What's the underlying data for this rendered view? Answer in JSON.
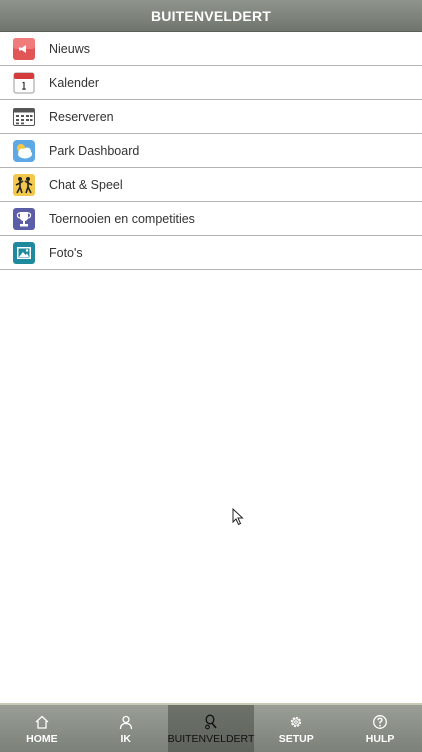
{
  "header": {
    "title": "BUITENVELDERT"
  },
  "menu": {
    "items": [
      {
        "label": "Nieuws",
        "icon": "megaphone-icon"
      },
      {
        "label": "Kalender",
        "icon": "calendar-icon"
      },
      {
        "label": "Reserveren",
        "icon": "reservation-grid-icon"
      },
      {
        "label": "Park Dashboard",
        "icon": "weather-cloud-icon"
      },
      {
        "label": "Chat & Speel",
        "icon": "players-icon"
      },
      {
        "label": "Toernooien en competities",
        "icon": "trophy-icon"
      },
      {
        "label": "Foto's",
        "icon": "photo-icon"
      }
    ]
  },
  "tabbar": {
    "tabs": [
      {
        "label": "HOME",
        "icon": "home-icon"
      },
      {
        "label": "IK",
        "icon": "user-icon"
      },
      {
        "label": "BUITENVELDERT",
        "icon": "tennis-racket-icon",
        "active": true
      },
      {
        "label": "SETUP",
        "icon": "gear-icon"
      },
      {
        "label": "HULP",
        "icon": "help-icon"
      }
    ]
  },
  "colors": {
    "header_bg": "#7f857c",
    "tabbar_bg": "#8a8f87",
    "active_tab_bg": "#656a63",
    "divider": "#b3b3b3"
  }
}
